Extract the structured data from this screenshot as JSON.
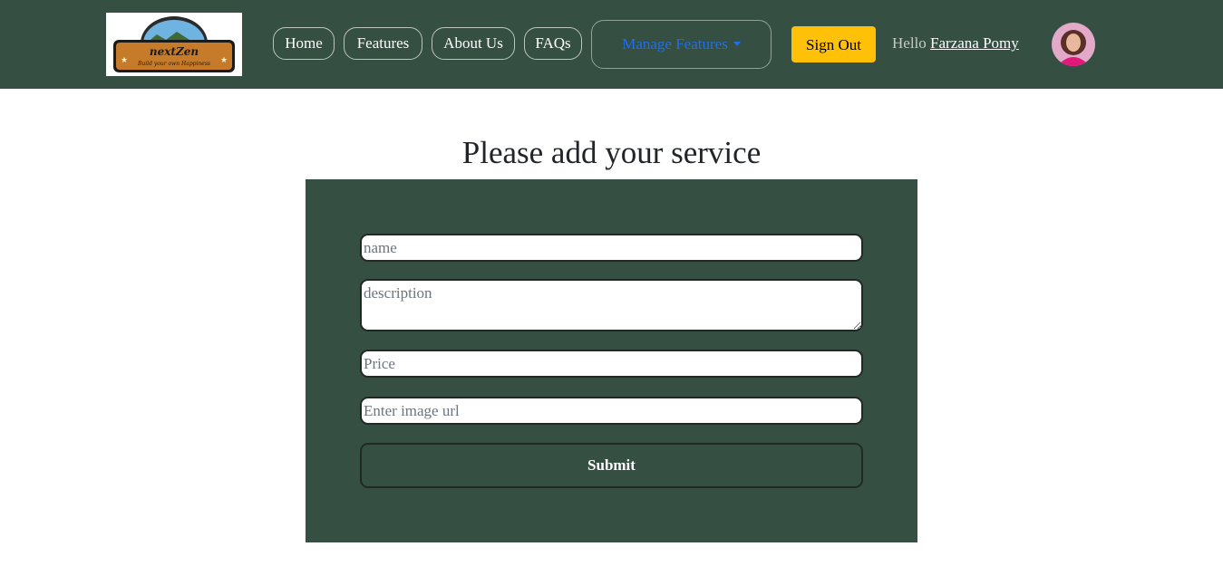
{
  "brand": {
    "logo_name": "nextZen",
    "logo_tagline": "Build your own Happiness"
  },
  "nav": {
    "items": [
      {
        "label": "Home"
      },
      {
        "label": "Features"
      },
      {
        "label": "About Us"
      },
      {
        "label": "FAQs"
      }
    ],
    "manage_label": "Manage Features"
  },
  "user": {
    "signout_label": "Sign Out",
    "greeting": "Hello",
    "name": "Farzana Pomy"
  },
  "form": {
    "title": "Please add your service",
    "name_placeholder": "name",
    "description_placeholder": "description",
    "price_placeholder": "Price",
    "image_placeholder": "Enter image url",
    "submit_label": "Submit"
  },
  "colors": {
    "primary_green": "#354f42",
    "signout_yellow": "#ffc107",
    "dropdown_blue": "#1f6feb"
  }
}
